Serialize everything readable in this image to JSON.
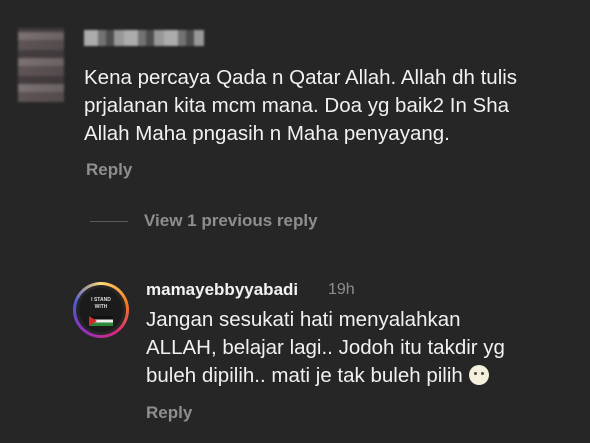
{
  "comment_1": {
    "text": "Kena percaya Qada n Qatar Allah. Allah dh tulis\nprjalanan kita mcm mana. Doa yg baik2 In Sha\nAllah Maha pngasih n Maha penyayang.",
    "reply_label": "Reply"
  },
  "view_replies_label": "View 1 previous reply",
  "reply_1": {
    "username": "mamayebbyyabadi",
    "time": "19h",
    "avatar_text_1": "I STAND",
    "avatar_text_2": "WITH",
    "text_line_1": "Jangan sesukati hati menyalahkan",
    "text_line_2": "ALLAH, belajar lagi.. Jodoh itu takdir yg",
    "text_line_3": "buleh dipilih.. mati je tak buleh pilih",
    "emoji": "pale-face-emoji",
    "reply_label": "Reply"
  },
  "colors": {
    "background": "#262626",
    "primary_text": "#f1f1f1",
    "secondary_text": "#8e8e8e"
  }
}
